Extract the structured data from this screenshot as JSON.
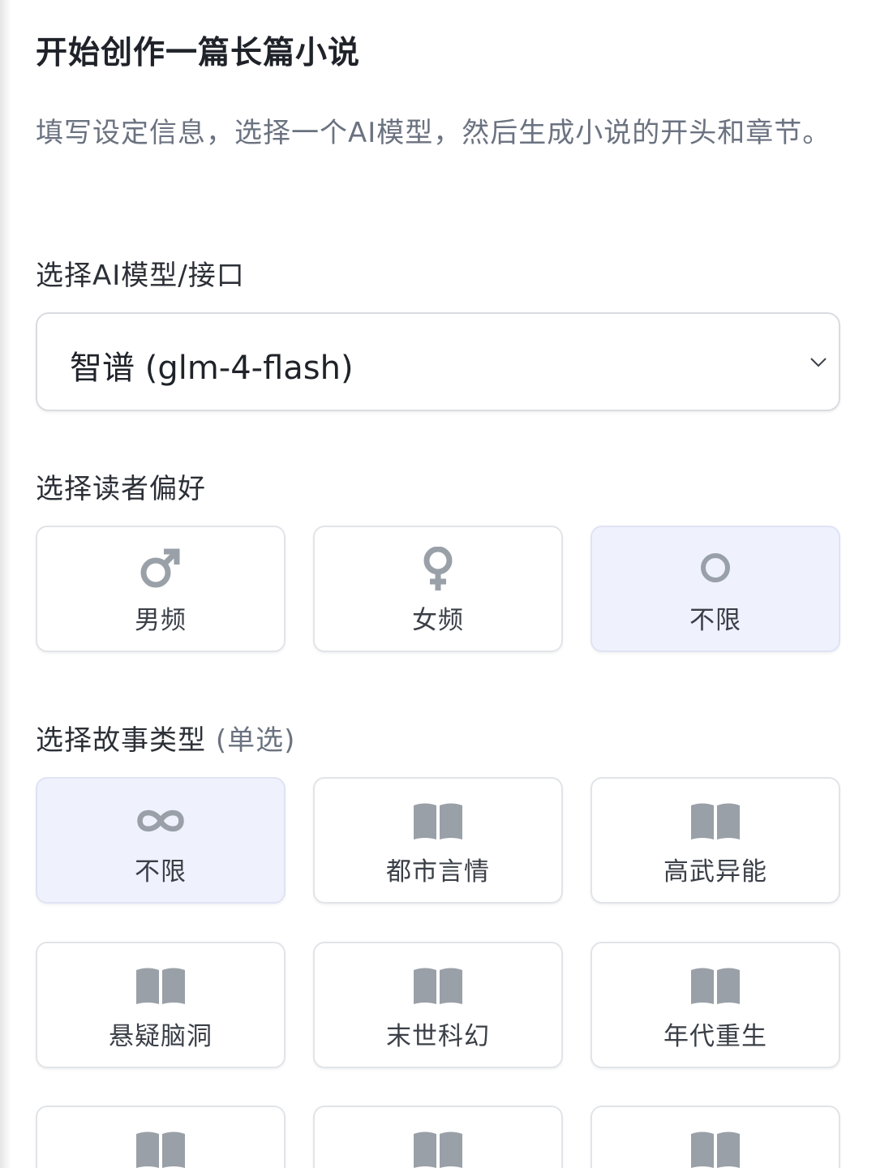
{
  "header": {
    "title": "开始创作一篇长篇小说",
    "description": "填写设定信息，选择一个AI模型，然后生成小说的开头和章节。"
  },
  "model": {
    "label": "选择AI模型/接口",
    "selected": "智谱 (glm-4-flash)"
  },
  "audience": {
    "label": "选择读者偏好",
    "options": [
      {
        "label": "男频",
        "icon": "male-symbol-icon",
        "selected": false
      },
      {
        "label": "女频",
        "icon": "female-symbol-icon",
        "selected": false
      },
      {
        "label": "不限",
        "icon": "circle-icon",
        "selected": true
      }
    ]
  },
  "genre": {
    "label": "选择故事类型",
    "hint": "(单选)",
    "options": [
      {
        "label": "不限",
        "icon": "infinity-icon",
        "selected": true
      },
      {
        "label": "都市言情",
        "icon": "book-icon",
        "selected": false
      },
      {
        "label": "高武异能",
        "icon": "book-icon",
        "selected": false
      },
      {
        "label": "悬疑脑洞",
        "icon": "book-icon",
        "selected": false
      },
      {
        "label": "末世科幻",
        "icon": "book-icon",
        "selected": false
      },
      {
        "label": "年代重生",
        "icon": "book-icon",
        "selected": false
      },
      {
        "label": "",
        "icon": "book-icon",
        "selected": false
      },
      {
        "label": "",
        "icon": "book-icon",
        "selected": false
      },
      {
        "label": "",
        "icon": "book-icon",
        "selected": false
      }
    ]
  },
  "colors": {
    "selected_bg": "#eff2fd",
    "icon_gray": "#9aa0a8",
    "border": "#e1e4e8"
  }
}
